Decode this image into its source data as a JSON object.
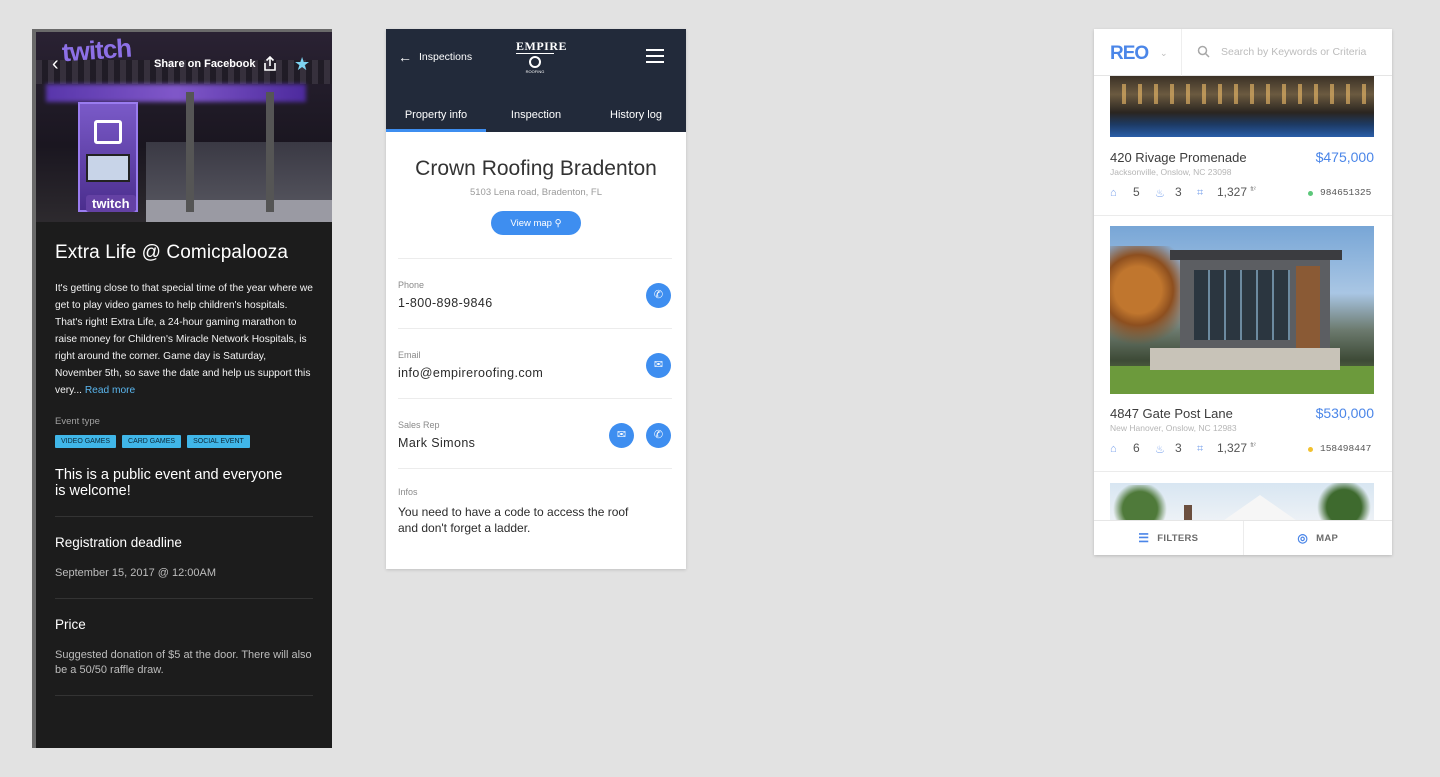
{
  "event": {
    "header": {
      "back_icon": "‹",
      "share_label": "Share on Facebook",
      "share_icon": "share-icon",
      "favorite_icon": "★",
      "photo_wordmark": "twitch",
      "photo_booth_wordmark": "twitch"
    },
    "title": "Extra Life @ Comicpalooza",
    "description": "It's getting close to that special time of the year where we get to play video games to help children's hospitals. That's right! Extra Life, a 24-hour gaming marathon to raise money for Children's Miracle Network Hospitals, is right around the corner. Game day is Saturday, November 5th, so save the date and help us support this very...",
    "read_more": "Read more",
    "event_type_label": "Event type",
    "tags": [
      "VIDEO GAMES",
      "CARD GAMES",
      "SOCIAL EVENT"
    ],
    "public_note": "This is a public event and everyone is welcome!",
    "registration": {
      "title": "Registration deadline",
      "value": "September 15, 2017 @ 12:00AM"
    },
    "price": {
      "title": "Price",
      "value": "Suggested donation of $5 at the door. There will also be a 50/50 raffle draw."
    }
  },
  "roofing": {
    "header": {
      "back_icon": "←",
      "back_label": "Inspections",
      "brand_word": "EMPIRE",
      "brand_sub": "ROOFING"
    },
    "tabs": [
      {
        "label": "Property info",
        "active": true
      },
      {
        "label": "Inspection",
        "active": false
      },
      {
        "label": "History log",
        "active": false
      }
    ],
    "company": "Crown Roofing Bradenton",
    "address": "5103 Lena road, Bradenton, FL",
    "view_map_label": "View map",
    "phone": {
      "label": "Phone",
      "value": "1-800-898-9846"
    },
    "email": {
      "label": "Email",
      "value": "info@empireroofing.com"
    },
    "sales_rep": {
      "label": "Sales Rep",
      "value": "Mark Simons"
    },
    "infos": {
      "label": "Infos",
      "value": "You need to have a code to access the roof and don't forget a ladder."
    },
    "accent_color": "#3e8ef0"
  },
  "reo": {
    "logo": "REO",
    "search_placeholder": "Search by Keywords or Criteria",
    "listings": [
      {
        "title": "420 Rivage Promenade",
        "price": "$475,000",
        "location": "Jacksonville, Onslow, NC 23098",
        "beds": "5",
        "baths": "3",
        "sqft": "1,327",
        "sqft_unit": "ft²",
        "mls": "984651325",
        "status_color": "#5cc77a"
      },
      {
        "title": "4847 Gate Post Lane",
        "price": "$530,000",
        "location": "New Hanover, Onslow, NC 12983",
        "beds": "6",
        "baths": "3",
        "sqft": "1,327",
        "sqft_unit": "ft²",
        "mls": "158498447",
        "status_color": "#f2c12e"
      }
    ],
    "filters_label": "FILTERS",
    "map_label": "MAP",
    "accent_color": "#4b86e8"
  }
}
